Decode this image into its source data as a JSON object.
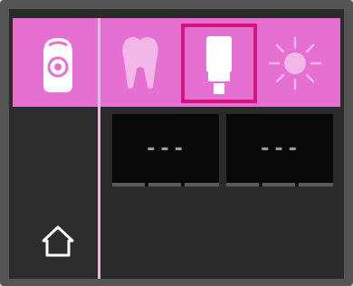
{
  "tabs": [
    {
      "icon": "device-sensor-icon",
      "selected": false
    },
    {
      "icon": "tooth-icon",
      "selected": false
    },
    {
      "icon": "tube-icon",
      "selected": true
    },
    {
      "icon": "sun-icon",
      "selected": false
    }
  ],
  "readouts": [
    {
      "value": "---"
    },
    {
      "value": "---"
    }
  ],
  "nav": {
    "home_icon": "home-icon"
  },
  "colors": {
    "accent": "#e670d2",
    "selected_border": "#d6147f",
    "background": "#2a2a2a"
  }
}
